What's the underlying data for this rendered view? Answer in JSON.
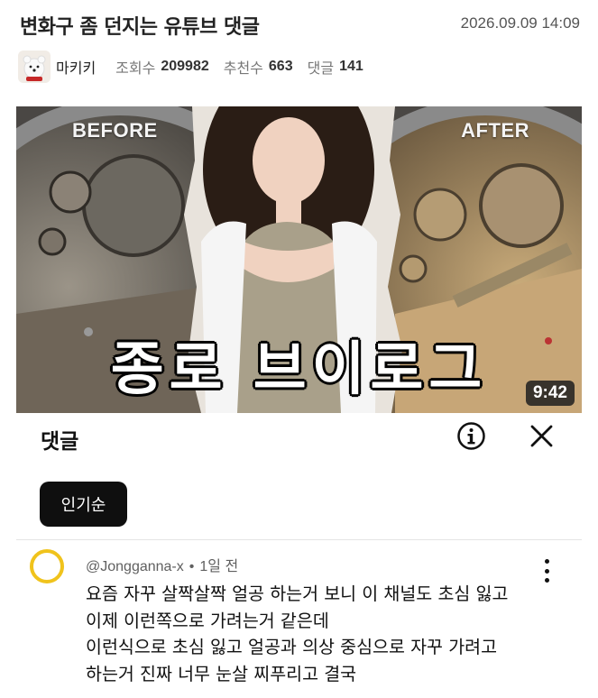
{
  "post": {
    "title": "변화구 좀 던지는 유튜브 댓글",
    "date": "2026.09.09 14:09",
    "author": "마키키",
    "views_label": "조회수",
    "views": "209982",
    "likes_label": "추천수",
    "likes": "663",
    "comments_label": "댓글",
    "comments": "141"
  },
  "video": {
    "before_label": "BEFORE",
    "after_label": "AFTER",
    "caption": "종로 브이로그",
    "duration": "9:42"
  },
  "comments_panel": {
    "title": "댓글",
    "sort_chip": "인기순",
    "info_icon": "info-circle-icon",
    "close_icon": "close-icon"
  },
  "comment": {
    "username": "@Jongganna-x",
    "separator": "•",
    "time": "1일 전",
    "lines": [
      "요즘 자꾸 살짝살짝 얼공 하는거 보니 이 채널도 초심 잃고",
      "이제 이런쪽으로 가려는거 같은데",
      "이런식으로 초심 잃고 얼공과 의상 중심으로 자꾸 가려고",
      "하는거 진짜 너무 눈살 찌푸리고 결국"
    ]
  },
  "colors": {
    "chip_bg": "#0f0f0f",
    "avatar_ring": "#f0c31c",
    "muted_text": "#606060"
  }
}
